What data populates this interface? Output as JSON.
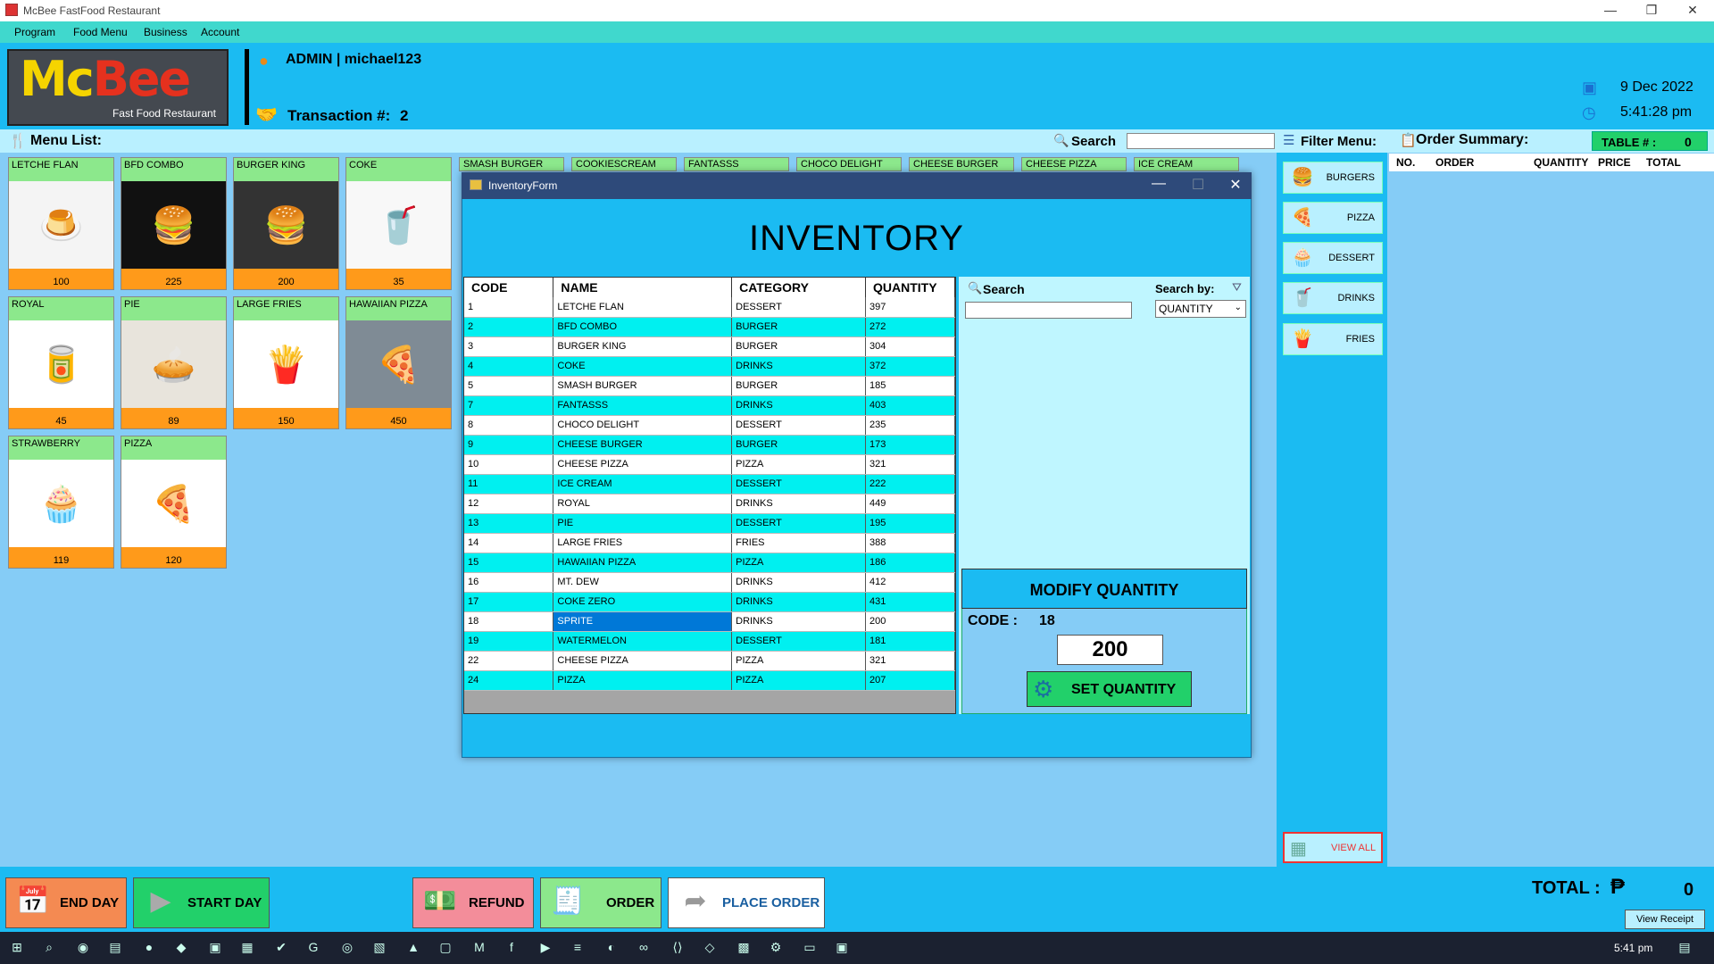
{
  "window": {
    "title": "McBee FastFood Restaurant"
  },
  "menubar": [
    "Program",
    "Food Menu",
    "Business",
    "Account"
  ],
  "header": {
    "logo_main_1": "Mc",
    "logo_main_2": "Bee",
    "logo_sub": "Fast Food Restaurant",
    "user": "ADMIN | michael123",
    "transaction_label": "Transaction #:",
    "transaction_value": "2",
    "date": "9 Dec 2022",
    "time": "5:41:28 pm"
  },
  "menu_list": {
    "label": "Menu List:",
    "search_label": "Search",
    "items": [
      {
        "name": "LETCHE FLAN",
        "price": "100",
        "icon": "🍮"
      },
      {
        "name": "BFD COMBO",
        "price": "225",
        "icon": "🍔"
      },
      {
        "name": "BURGER KING",
        "price": "200",
        "icon": "🍔"
      },
      {
        "name": "COKE",
        "price": "35",
        "icon": "🥤"
      },
      {
        "name": "ROYAL",
        "price": "45",
        "icon": "🥫"
      },
      {
        "name": "PIE",
        "price": "89",
        "icon": "🥧"
      },
      {
        "name": "LARGE FRIES",
        "price": "150",
        "icon": "🍟"
      },
      {
        "name": "HAWAIIAN PIZZA",
        "price": "450",
        "icon": "🍕"
      },
      {
        "name": "STRAWBERRY",
        "price": "119",
        "icon": "🧁"
      },
      {
        "name": "PIZZA",
        "price": "120",
        "icon": "🍕"
      }
    ],
    "hidden_tabs": [
      "SMASH BURGER",
      "COOKIESCREAM",
      "FANTASSS",
      "CHOCO DELIGHT",
      "CHEESE BURGER",
      "CHEESE PIZZA",
      "ICE CREAM"
    ]
  },
  "filter": {
    "label": "Filter Menu:",
    "buttons": [
      "BURGERS",
      "PIZZA",
      "DESSERT",
      "DRINKS",
      "FRIES"
    ],
    "view_all": "VIEW ALL"
  },
  "order_summary": {
    "label": "Order Summary:",
    "table_label": "TABLE # :",
    "table_value": "0",
    "columns": [
      "NO.",
      "ORDER",
      "QUANTITY",
      "PRICE",
      "TOTAL"
    ]
  },
  "bottom": {
    "end_day": "END DAY",
    "start_day": "START DAY",
    "refund": "REFUND",
    "order": "ORDER",
    "place_order": "PLACE ORDER",
    "total_label": "TOTAL :",
    "currency": "₱",
    "total_value": "0",
    "view_receipt": "View Receipt"
  },
  "inventory": {
    "window_title": "InventoryForm",
    "heading": "INVENTORY",
    "columns": [
      "CODE",
      "NAME",
      "CATEGORY",
      "QUANTITY"
    ],
    "rows": [
      [
        "1",
        "LETCHE FLAN",
        "DESSERT",
        "397"
      ],
      [
        "2",
        "BFD COMBO",
        "BURGER",
        "272"
      ],
      [
        "3",
        "BURGER KING",
        "BURGER",
        "304"
      ],
      [
        "4",
        "COKE",
        "DRINKS",
        "372"
      ],
      [
        "5",
        "SMASH BURGER",
        "BURGER",
        "185"
      ],
      [
        "7",
        "FANTASSS",
        "DRINKS",
        "403"
      ],
      [
        "8",
        "CHOCO DELIGHT",
        "DESSERT",
        "235"
      ],
      [
        "9",
        "CHEESE BURGER",
        "BURGER",
        "173"
      ],
      [
        "10",
        "CHEESE PIZZA",
        "PIZZA",
        "321"
      ],
      [
        "11",
        "ICE CREAM",
        "DESSERT",
        "222"
      ],
      [
        "12",
        "ROYAL",
        "DRINKS",
        "449"
      ],
      [
        "13",
        "PIE",
        "DESSERT",
        "195"
      ],
      [
        "14",
        "LARGE FRIES",
        "FRIES",
        "388"
      ],
      [
        "15",
        "HAWAIIAN PIZZA",
        "PIZZA",
        "186"
      ],
      [
        "16",
        "MT. DEW",
        "DRINKS",
        "412"
      ],
      [
        "17",
        "COKE ZERO",
        "DRINKS",
        "431"
      ],
      [
        "18",
        "SPRITE",
        "DRINKS",
        "200"
      ],
      [
        "19",
        "WATERMELON",
        "DESSERT",
        "181"
      ],
      [
        "22",
        "CHEESE PIZZA",
        "PIZZA",
        "321"
      ],
      [
        "24",
        "PIZZA",
        "PIZZA",
        "207"
      ]
    ],
    "selected_row_index": 16,
    "search_label": "Search",
    "search_value": "",
    "search_by_label": "Search by:",
    "search_by_value": "QUANTITY",
    "modify_heading": "MODIFY QUANTITY",
    "code_label": "CODE :",
    "code_value": "18",
    "quantity_value": "200",
    "set_quantity": "SET QUANTITY"
  },
  "taskbar": {
    "time": "5:41 pm"
  },
  "colors": {
    "accent": "#1BBBF2",
    "light": "#B9F0FF",
    "green": "#22D06A",
    "orange": "#FF9A1A",
    "row_cyan": "#00F0F0",
    "selection": "#0078D7"
  }
}
